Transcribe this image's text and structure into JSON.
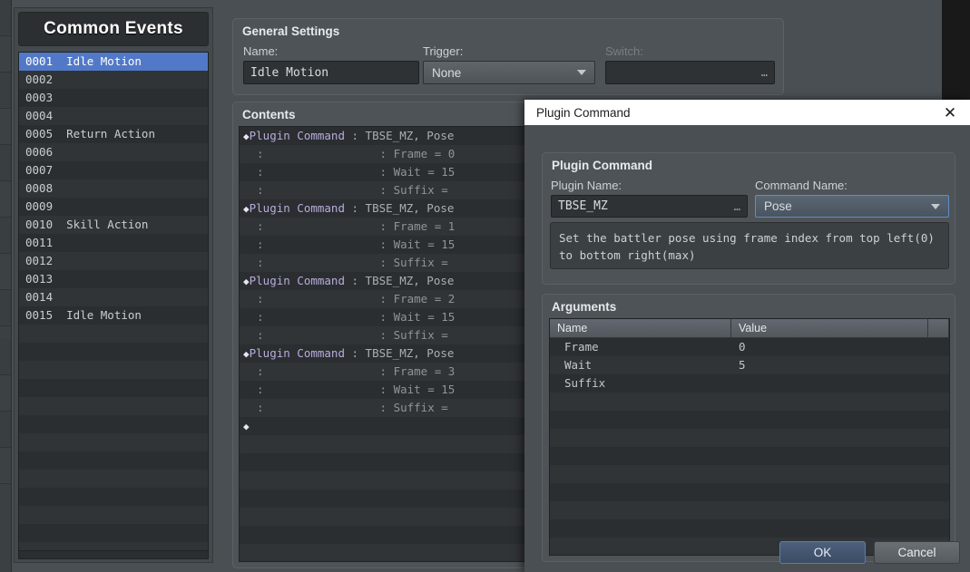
{
  "common_events": {
    "title": "Common Events",
    "rows": [
      {
        "id": "0001",
        "name": "Idle Motion",
        "selected": true
      },
      {
        "id": "0002",
        "name": "",
        "selected": false
      },
      {
        "id": "0003",
        "name": "",
        "selected": false
      },
      {
        "id": "0004",
        "name": "",
        "selected": false
      },
      {
        "id": "0005",
        "name": "Return Action",
        "selected": false
      },
      {
        "id": "0006",
        "name": "",
        "selected": false
      },
      {
        "id": "0007",
        "name": "",
        "selected": false
      },
      {
        "id": "0008",
        "name": "",
        "selected": false
      },
      {
        "id": "0009",
        "name": "",
        "selected": false
      },
      {
        "id": "0010",
        "name": "Skill Action",
        "selected": false
      },
      {
        "id": "0011",
        "name": "",
        "selected": false
      },
      {
        "id": "0012",
        "name": "",
        "selected": false
      },
      {
        "id": "0013",
        "name": "",
        "selected": false
      },
      {
        "id": "0014",
        "name": "",
        "selected": false
      },
      {
        "id": "0015",
        "name": "Idle Motion",
        "selected": false
      }
    ]
  },
  "general_settings": {
    "title": "General Settings",
    "name_label": "Name:",
    "name_value": "Idle Motion",
    "trigger_label": "Trigger:",
    "trigger_value": "None",
    "switch_label": "Switch:",
    "switch_value": "",
    "switch_browse": "…"
  },
  "contents": {
    "title": "Contents",
    "rows": [
      {
        "marker": "◆",
        "cmd": "Plugin Command",
        "sep": " : ",
        "text": "TBSE_MZ, Pose"
      },
      {
        "marker": "",
        "cmd": "",
        "sep": "",
        "text": "",
        "indent": ":                 : Frame = 0"
      },
      {
        "marker": "",
        "cmd": "",
        "sep": "",
        "text": "",
        "indent": ":                 : Wait = 15"
      },
      {
        "marker": "",
        "cmd": "",
        "sep": "",
        "text": "",
        "indent": ":                 : Suffix ="
      },
      {
        "marker": "◆",
        "cmd": "Plugin Command",
        "sep": " : ",
        "text": "TBSE_MZ, Pose"
      },
      {
        "marker": "",
        "cmd": "",
        "sep": "",
        "text": "",
        "indent": ":                 : Frame = 1"
      },
      {
        "marker": "",
        "cmd": "",
        "sep": "",
        "text": "",
        "indent": ":                 : Wait = 15"
      },
      {
        "marker": "",
        "cmd": "",
        "sep": "",
        "text": "",
        "indent": ":                 : Suffix ="
      },
      {
        "marker": "◆",
        "cmd": "Plugin Command",
        "sep": " : ",
        "text": "TBSE_MZ, Pose"
      },
      {
        "marker": "",
        "cmd": "",
        "sep": "",
        "text": "",
        "indent": ":                 : Frame = 2"
      },
      {
        "marker": "",
        "cmd": "",
        "sep": "",
        "text": "",
        "indent": ":                 : Wait = 15"
      },
      {
        "marker": "",
        "cmd": "",
        "sep": "",
        "text": "",
        "indent": ":                 : Suffix ="
      },
      {
        "marker": "◆",
        "cmd": "Plugin Command",
        "sep": " : ",
        "text": "TBSE_MZ, Pose"
      },
      {
        "marker": "",
        "cmd": "",
        "sep": "",
        "text": "",
        "indent": ":                 : Frame = 3"
      },
      {
        "marker": "",
        "cmd": "",
        "sep": "",
        "text": "",
        "indent": ":                 : Wait = 15"
      },
      {
        "marker": "",
        "cmd": "",
        "sep": "",
        "text": "",
        "indent": ":                 : Suffix ="
      },
      {
        "marker": "◆",
        "cmd": "",
        "sep": "",
        "text": ""
      }
    ]
  },
  "dialog": {
    "title": "Plugin Command",
    "close_icon": "✕",
    "plugin_group_title": "Plugin Command",
    "plugin_name_label": "Plugin Name:",
    "plugin_name_value": "TBSE_MZ",
    "plugin_name_browse": "…",
    "command_name_label": "Command Name:",
    "command_name_value": "Pose",
    "description": "Set the battler pose using frame index from top left(0) to bottom right(max)",
    "arguments_title": "Arguments",
    "arguments_columns": [
      "Name",
      "Value"
    ],
    "arguments_rows": [
      {
        "name": "Frame",
        "value": "0"
      },
      {
        "name": "Wait",
        "value": "5"
      },
      {
        "name": "Suffix",
        "value": ""
      }
    ],
    "ok_label": "OK",
    "cancel_label": "Cancel"
  },
  "colors": {
    "selection_blue": "#5279c7",
    "plugin_command_purple": "#b9abdd",
    "focus_border": "#5f8fc4",
    "panel_bg": "#4a4f53",
    "list_bg": "#2a2e30"
  }
}
